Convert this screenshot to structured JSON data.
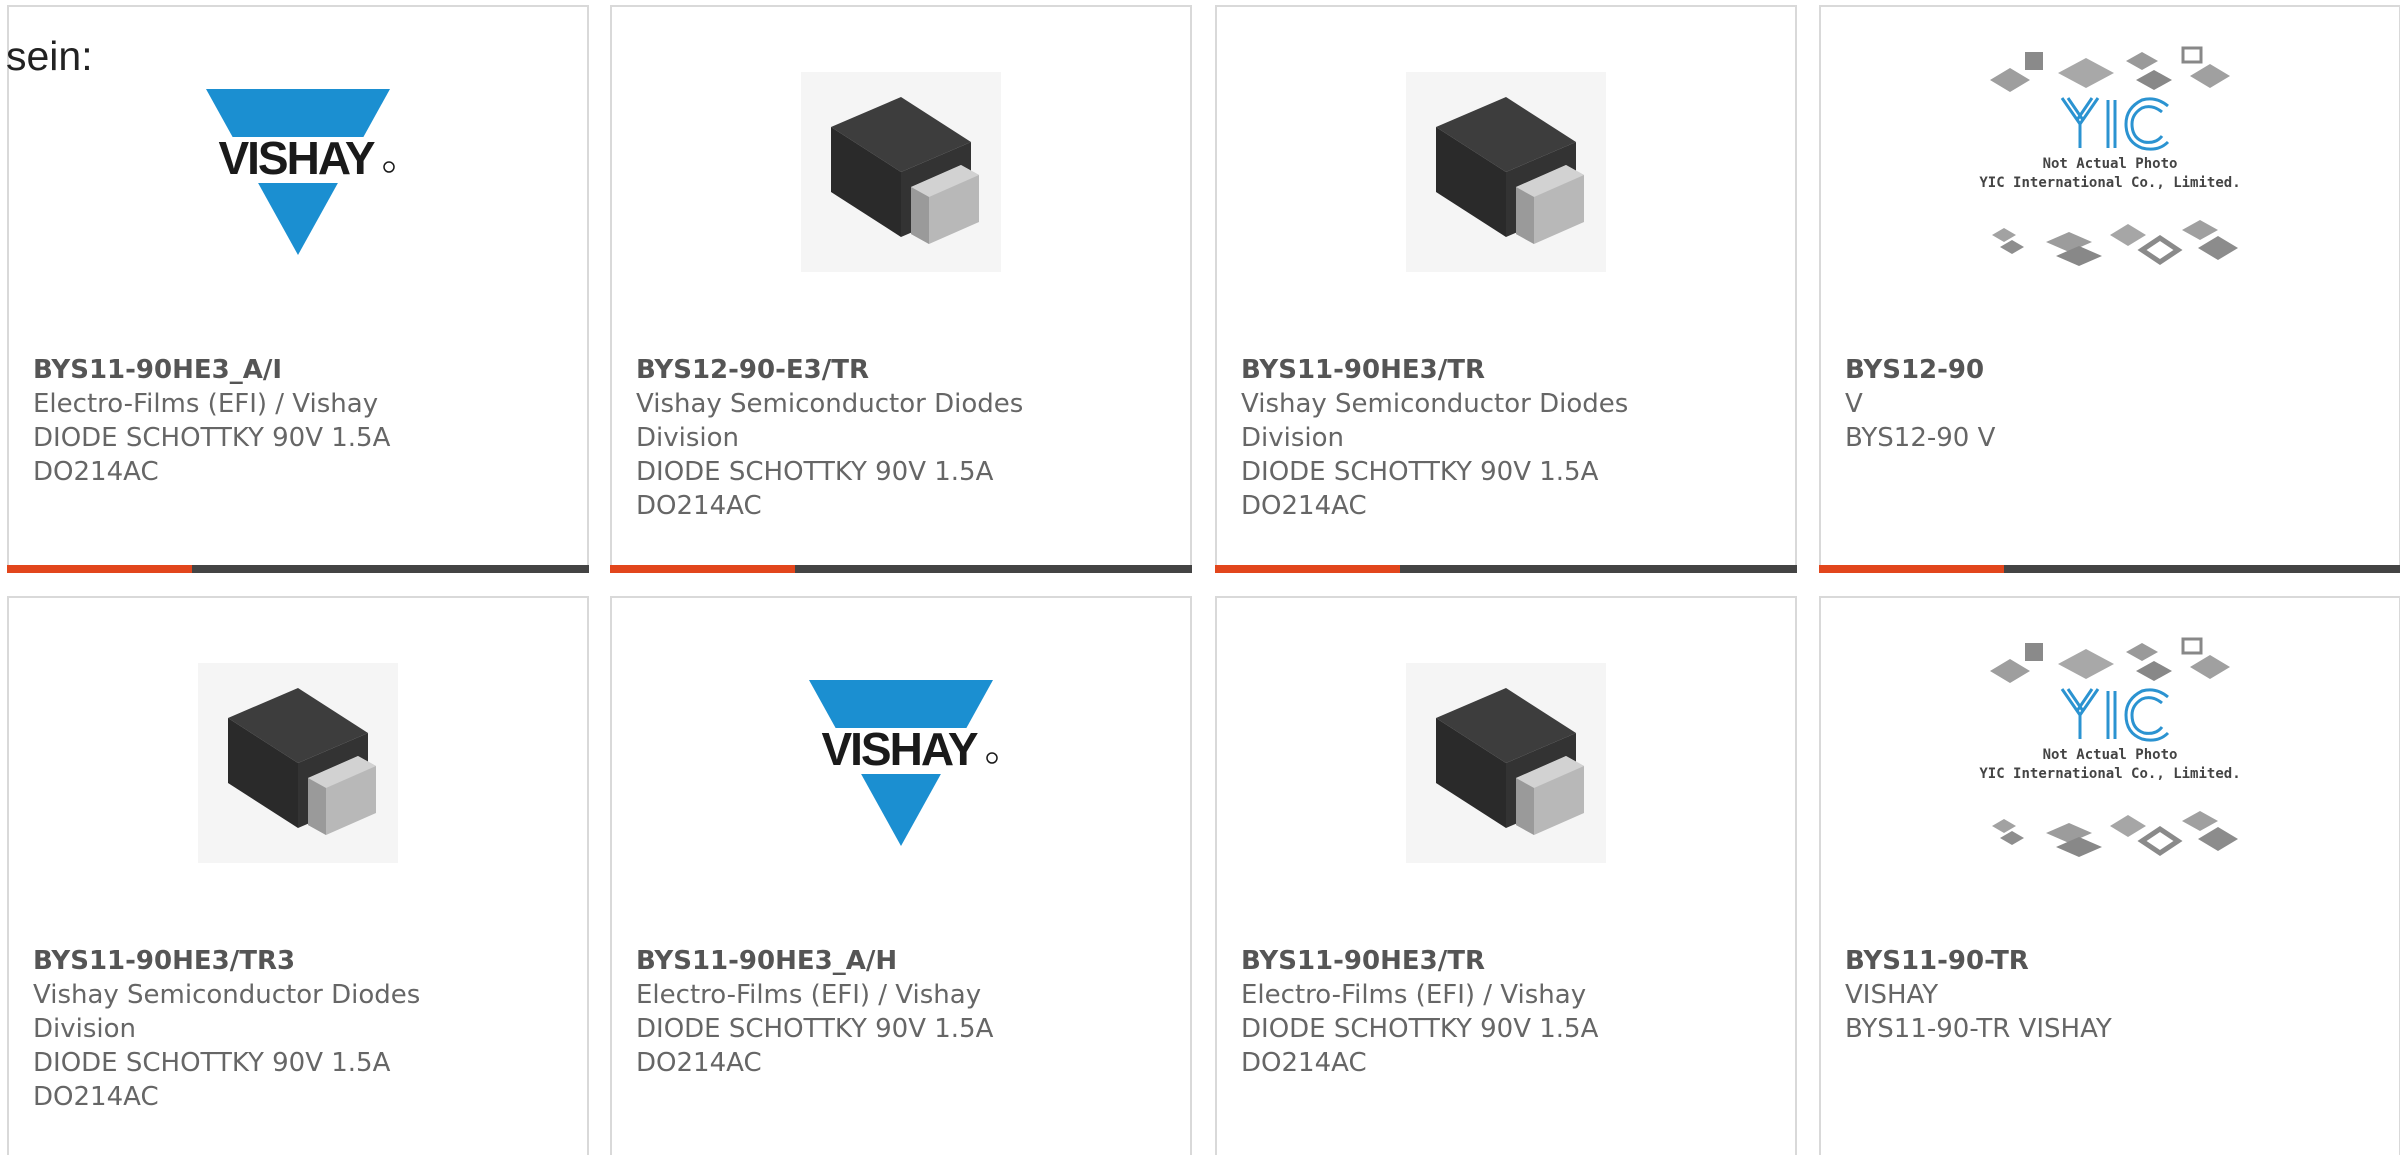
{
  "lead_text": "sein:",
  "colors": {
    "accent": "#e2461c",
    "bar": "#444444",
    "vishay_blue": "#1b8fd1",
    "yic_blue": "#2b93d1"
  },
  "products": [
    {
      "part_number": "BYS11-90HE3_A/I",
      "manufacturer_lines": [
        "Electro-Films (EFI) / Vishay"
      ],
      "description_lines": [
        "DIODE SCHOTTKY 90V 1.5A",
        "DO214AC"
      ],
      "image": "vishay-logo"
    },
    {
      "part_number": "BYS12-90-E3/TR",
      "manufacturer_lines": [
        "Vishay Semiconductor Diodes",
        "Division"
      ],
      "description_lines": [
        "DIODE SCHOTTKY 90V 1.5A",
        "DO214AC"
      ],
      "image": "diode-package"
    },
    {
      "part_number": "BYS11-90HE3/TR",
      "manufacturer_lines": [
        "Vishay Semiconductor Diodes",
        "Division"
      ],
      "description_lines": [
        "DIODE SCHOTTKY 90V 1.5A",
        "DO214AC"
      ],
      "image": "diode-package"
    },
    {
      "part_number": "BYS12-90",
      "manufacturer_lines": [
        "V"
      ],
      "description_lines": [
        "BYS12-90 V"
      ],
      "image": "yic-placeholder",
      "image_text": [
        "Not Actual Photo",
        "YIC International Co., Limited."
      ]
    },
    {
      "part_number": "BYS11-90HE3/TR3",
      "manufacturer_lines": [
        "Vishay Semiconductor Diodes",
        "Division"
      ],
      "description_lines": [
        "DIODE SCHOTTKY 90V 1.5A",
        "DO214AC"
      ],
      "image": "diode-package"
    },
    {
      "part_number": "BYS11-90HE3_A/H",
      "manufacturer_lines": [
        "Electro-Films (EFI) / Vishay"
      ],
      "description_lines": [
        "DIODE SCHOTTKY 90V 1.5A",
        "DO214AC"
      ],
      "image": "vishay-logo"
    },
    {
      "part_number": "BYS11-90HE3/TR",
      "manufacturer_lines": [
        "Electro-Films (EFI) / Vishay"
      ],
      "description_lines": [
        "DIODE SCHOTTKY 90V 1.5A",
        "DO214AC"
      ],
      "image": "diode-package"
    },
    {
      "part_number": "BYS11-90-TR",
      "manufacturer_lines": [
        "VISHAY"
      ],
      "description_lines": [
        "BYS11-90-TR VISHAY"
      ],
      "image": "yic-placeholder",
      "image_text": [
        "Not Actual Photo",
        "YIC International Co., Limited."
      ]
    }
  ],
  "logo_text": "VISHAY"
}
